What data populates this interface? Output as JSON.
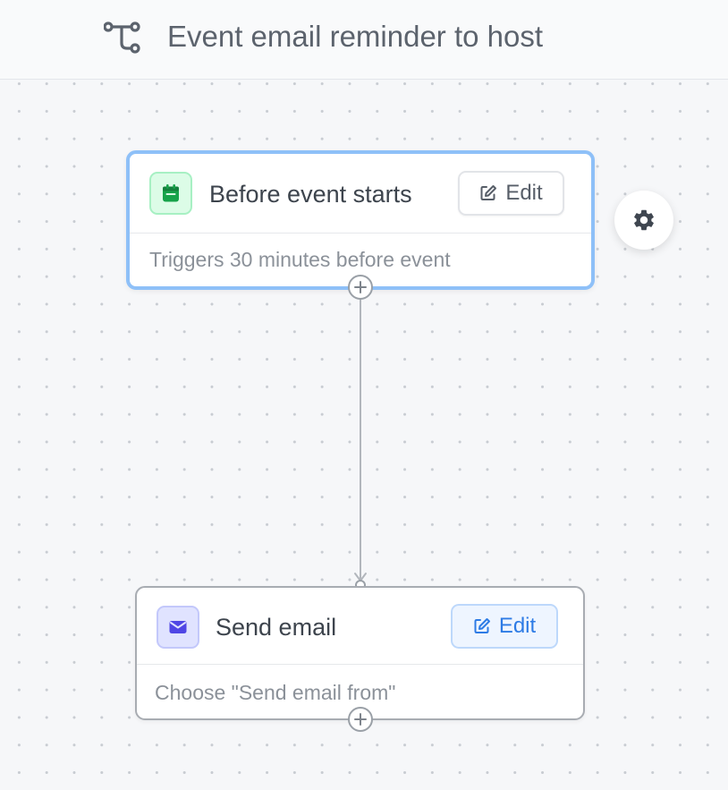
{
  "header": {
    "title": "Event email reminder to host",
    "icon": "workflow-icon"
  },
  "nodes": [
    {
      "kind": "trigger",
      "title": "Before event starts",
      "description": "Triggers 30 minutes before event",
      "edit_label": "Edit",
      "icon": "calendar-icon",
      "icon_color": "#16a34a"
    },
    {
      "kind": "action",
      "title": "Send email",
      "description": "Choose \"Send email from\"",
      "edit_label": "Edit",
      "icon": "mail-icon",
      "icon_color": "#4f46e5"
    }
  ],
  "settings": {
    "icon": "gear-icon"
  },
  "colors": {
    "selected_border": "#8ec0f8",
    "accent_blue": "#2d7be5",
    "canvas_background": "#f6f7f9"
  }
}
